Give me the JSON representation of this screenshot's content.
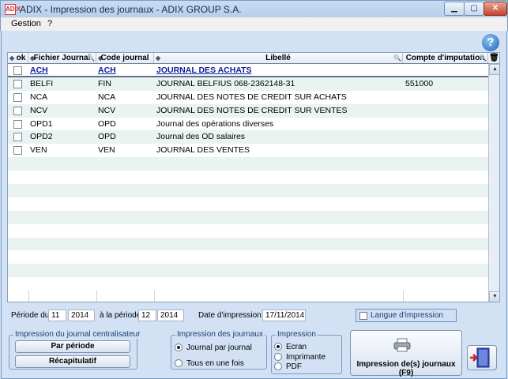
{
  "window": {
    "title": "ADIX - Impression des journaux - ADIX GROUP S.A.",
    "app_icon": "ADIX"
  },
  "menu": {
    "items": [
      "Gestion",
      "?"
    ]
  },
  "grid": {
    "headers": {
      "ok": "ok",
      "fichier_journal": "Fichier Journal",
      "code_journal": "Code journal",
      "libelle": "Libellé",
      "compte": "Compte d'imputation"
    },
    "rows": [
      {
        "fichier": "ACH",
        "code": "ACH",
        "libelle": "JOURNAL DES ACHATS",
        "compte": "",
        "selected": true
      },
      {
        "fichier": "BELFI",
        "code": "FIN",
        "libelle": "JOURNAL BELFIUS 068-2362148-31",
        "compte": "551000"
      },
      {
        "fichier": "NCA",
        "code": "NCA",
        "libelle": "JOURNAL DES NOTES DE CREDIT SUR ACHATS",
        "compte": ""
      },
      {
        "fichier": "NCV",
        "code": "NCV",
        "libelle": "JOURNAL DES NOTES DE CREDIT SUR VENTES",
        "compte": ""
      },
      {
        "fichier": "OPD1",
        "code": "OPD",
        "libelle": "Journal des opérations diverses",
        "compte": ""
      },
      {
        "fichier": "OPD2",
        "code": "OPD",
        "libelle": "Journal des OD salaires",
        "compte": ""
      },
      {
        "fichier": "VEN",
        "code": "VEN",
        "libelle": "JOURNAL DES VENTES",
        "compte": ""
      }
    ],
    "empty_rows": 10
  },
  "period": {
    "from_label": "Période du",
    "from_month": "11",
    "from_year": "2014",
    "to_label": "à la période",
    "to_month": "12",
    "to_year": "2014",
    "date_label": "Date d'impression",
    "date_value": "17/11/2014"
  },
  "language": {
    "label": "Langue d'impression"
  },
  "centralisateur": {
    "title": "Impression du journal centralisateur",
    "btn_periode": "Par période",
    "btn_recap": "Récapitulatif"
  },
  "impression_journaux": {
    "title": "Impression des journaux",
    "options": [
      "Journal par journal",
      "Tous en une fois"
    ],
    "selected": 0
  },
  "impression": {
    "title": "Impression",
    "options": [
      "Ecran",
      "Imprimante",
      "PDF"
    ],
    "selected": 0
  },
  "actions": {
    "print_label": "Impression de(s) journaux (F9)"
  }
}
